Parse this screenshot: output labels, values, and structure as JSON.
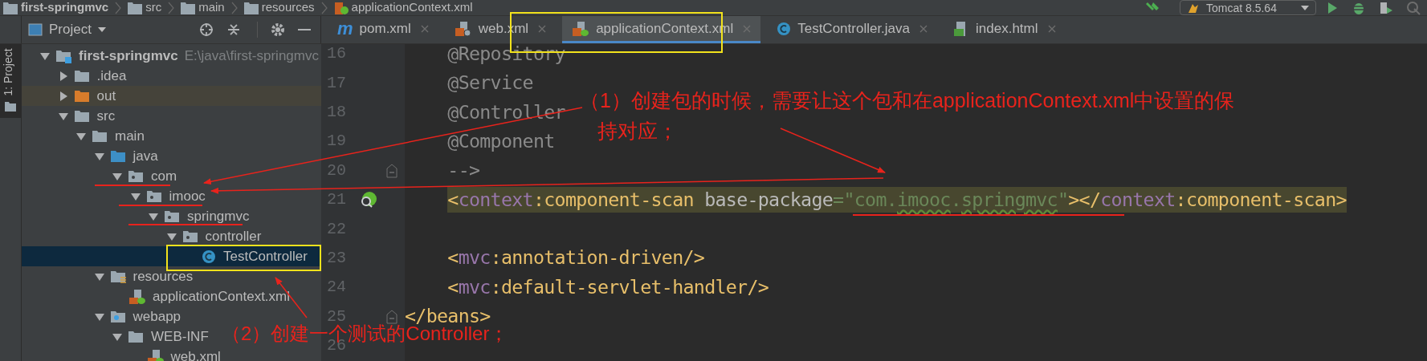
{
  "breadcrumbs": [
    "first-springmvc",
    "src",
    "main",
    "resources",
    "applicationContext.xml"
  ],
  "run_config": "Tomcat 8.5.64",
  "tool_strip": {
    "label": "1: Project"
  },
  "project_panel": {
    "title": "Project",
    "tree": [
      {
        "label": "first-springmvc",
        "path": "E:\\java\\first-springmvc",
        "kind": "module",
        "expanded": true,
        "selected": false,
        "children": [
          {
            "label": ".idea",
            "kind": "folder",
            "expanded": false,
            "selected": false
          },
          {
            "label": "out",
            "kind": "excluded",
            "expanded": false,
            "selected": false
          },
          {
            "label": "src",
            "kind": "folder",
            "expanded": true,
            "selected": false,
            "children": [
              {
                "label": "main",
                "kind": "folder",
                "expanded": true,
                "selected": false,
                "children": [
                  {
                    "label": "java",
                    "kind": "source-root",
                    "expanded": true,
                    "selected": false,
                    "children": [
                      {
                        "label": "com",
                        "kind": "package",
                        "expanded": true,
                        "selected": false,
                        "children": [
                          {
                            "label": "imooc",
                            "kind": "package",
                            "expanded": true,
                            "selected": false,
                            "children": [
                              {
                                "label": "springmvc",
                                "kind": "package",
                                "expanded": true,
                                "selected": false,
                                "children": [
                                  {
                                    "label": "controller",
                                    "kind": "package",
                                    "expanded": true,
                                    "selected": false,
                                    "children": [
                                      {
                                        "label": "TestController",
                                        "kind": "class",
                                        "selected": true
                                      }
                                    ]
                                  }
                                ]
                              }
                            ]
                          }
                        ]
                      }
                    ]
                  },
                  {
                    "label": "resources",
                    "kind": "resources-root",
                    "expanded": true,
                    "selected": false,
                    "children": [
                      {
                        "label": "applicationContext.xml",
                        "kind": "xml",
                        "selected": false
                      }
                    ]
                  },
                  {
                    "label": "webapp",
                    "kind": "web-root",
                    "expanded": true,
                    "selected": false,
                    "children": [
                      {
                        "label": "WEB-INF",
                        "kind": "folder",
                        "expanded": true,
                        "selected": false,
                        "children": [
                          {
                            "label": "web.xml",
                            "kind": "xml",
                            "selected": false
                          }
                        ]
                      }
                    ]
                  }
                ]
              }
            ]
          }
        ]
      }
    ]
  },
  "tabs": [
    {
      "label": "pom.xml",
      "kind": "maven",
      "icon_text": "m",
      "selected": false
    },
    {
      "label": "web.xml",
      "kind": "xml-web",
      "selected": false
    },
    {
      "label": "applicationContext.xml",
      "kind": "xml-spring",
      "selected": true
    },
    {
      "label": "TestController.java",
      "kind": "java-class",
      "selected": false
    },
    {
      "label": "index.html",
      "kind": "html",
      "selected": false
    }
  ],
  "editor": {
    "lines": [
      {
        "number": "16",
        "tokens": [
          {
            "kind": "comment",
            "text": "    @Repository"
          }
        ]
      },
      {
        "number": "17",
        "tokens": [
          {
            "kind": "comment",
            "text": "    @Service"
          }
        ]
      },
      {
        "number": "18",
        "tokens": [
          {
            "kind": "comment",
            "text": "    @Controller"
          }
        ]
      },
      {
        "number": "19",
        "tokens": [
          {
            "kind": "comment",
            "text": "    @Component"
          }
        ]
      },
      {
        "number": "20",
        "fold": true,
        "tokens": [
          {
            "kind": "comment",
            "text": "    -->"
          }
        ]
      },
      {
        "number": "21",
        "highlighted": true,
        "bean_icon": true,
        "tokens": [
          {
            "kind": "bracket",
            "text": "    <"
          },
          {
            "kind": "ns",
            "text": "context"
          },
          {
            "kind": "tag",
            "text": ":component-scan"
          },
          {
            "kind": "attr",
            "text": " base-package"
          },
          {
            "kind": "value",
            "text": "=\"com."
          },
          {
            "kind": "typo",
            "text": "imooc"
          },
          {
            "kind": "value",
            "text": "."
          },
          {
            "kind": "typo",
            "text": "springmvc"
          },
          {
            "kind": "value",
            "text": "\""
          },
          {
            "kind": "bracket",
            "text": "></"
          },
          {
            "kind": "ns",
            "text": "context"
          },
          {
            "kind": "tag",
            "text": ":component-scan>"
          }
        ]
      },
      {
        "number": "22"
      },
      {
        "number": "23",
        "tokens": [
          {
            "kind": "bracket",
            "text": "    <"
          },
          {
            "kind": "ns",
            "text": "mvc"
          },
          {
            "kind": "tag",
            "text": ":annotation-driven/>"
          }
        ]
      },
      {
        "number": "24",
        "tokens": [
          {
            "kind": "bracket",
            "text": "    <"
          },
          {
            "kind": "ns",
            "text": "mvc"
          },
          {
            "kind": "tag",
            "text": ":default-servlet-handler/>"
          }
        ]
      },
      {
        "number": "25",
        "fold": true,
        "tokens": [
          {
            "kind": "bracket",
            "text": "</"
          },
          {
            "kind": "tag",
            "text": "beans>"
          }
        ]
      },
      {
        "number": "26"
      }
    ]
  },
  "annotations": [
    {
      "lines": [
        "（1）创建包的时候，需要让这个包和在applicationContext.xml中设置的保",
        "持对应；"
      ]
    },
    {
      "lines": [
        "（2）创建一个测试的Controller；"
      ]
    }
  ]
}
